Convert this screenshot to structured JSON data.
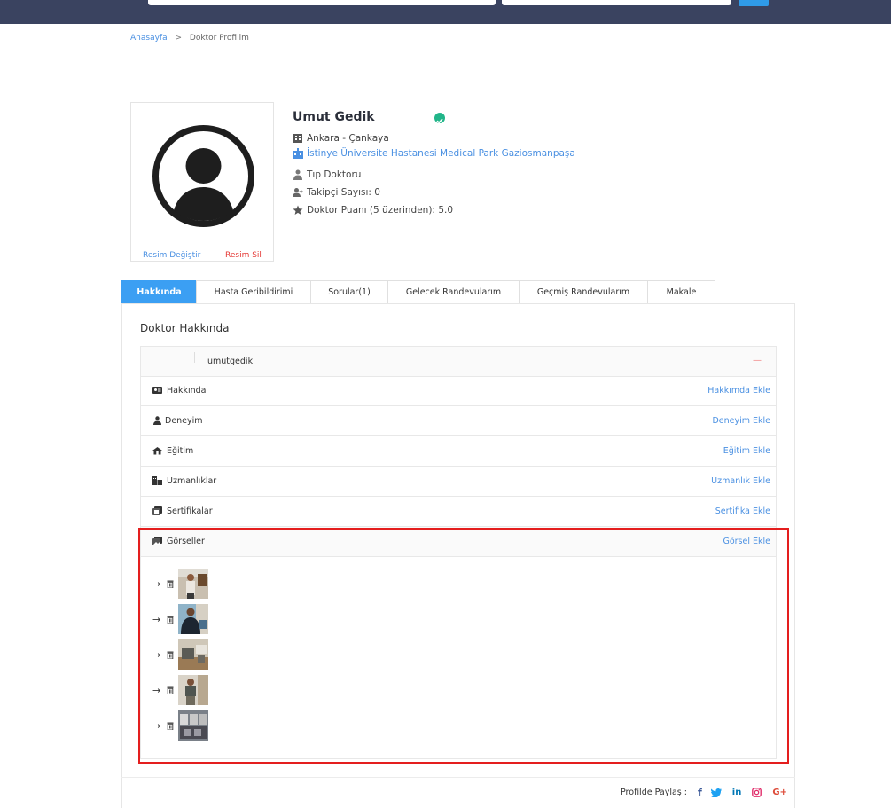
{
  "breadcrumb": {
    "home": "Anasayfa",
    "separator": ">",
    "current": "Doktor Profilim"
  },
  "photo": {
    "change_label": "Resim Değiştir",
    "delete_label": "Resim Sil"
  },
  "doctor": {
    "name": "Umut Gedik",
    "location": "Ankara - Çankaya",
    "hospital": "İstinye Üniversite Hastanesi Medical Park Gaziosmanpaşa",
    "title": "Tıp Doktoru",
    "followers": "Takipçi Sayısı: 0",
    "rating": "Doktor Puanı (5 üzerinden): 5.0"
  },
  "tabs": [
    {
      "label": "Hakkında",
      "active": true
    },
    {
      "label": "Hasta Geribildirimi"
    },
    {
      "label": "Sorular(1)"
    },
    {
      "label": "Gelecek Randevularım"
    },
    {
      "label": "Geçmiş Randevularım"
    },
    {
      "label": "Makale"
    }
  ],
  "about": {
    "title": "Doktor Hakkında",
    "username": "umutgedik",
    "collapse": "—",
    "sections": [
      {
        "label": "Hakkında",
        "action": "Hakkımda Ekle",
        "icon": "id-card-icon"
      },
      {
        "label": "Deneyim",
        "action": "Deneyim Ekle",
        "icon": "user-tie-icon"
      },
      {
        "label": "Eğitim",
        "action": "Eğitim Ekle",
        "icon": "graduation-icon"
      },
      {
        "label": "Uzmanlıklar",
        "action": "Uzmanlık Ekle",
        "icon": "user-md-icon"
      },
      {
        "label": "Sertifikalar",
        "action": "Sertifika Ekle",
        "icon": "certificate-icon"
      },
      {
        "label": "Görseller",
        "action": "Görsel Ekle",
        "icon": "images-icon"
      }
    ],
    "images": [
      {
        "arrow": "→"
      },
      {
        "arrow": "→"
      },
      {
        "arrow": "→"
      },
      {
        "arrow": "→"
      },
      {
        "arrow": "→"
      }
    ]
  },
  "share": {
    "label": "Profilde Paylaş :",
    "icons": [
      {
        "name": "facebook-icon",
        "glyph": "f",
        "color": "#3b5998"
      },
      {
        "name": "twitter-icon",
        "glyph": "🐦",
        "color": "#1da1f2"
      },
      {
        "name": "linkedin-icon",
        "glyph": "in",
        "color": "#0077b5"
      },
      {
        "name": "instagram-icon",
        "glyph": "◎",
        "color": "#e1306c"
      },
      {
        "name": "google-plus-icon",
        "glyph": "G+",
        "color": "#dd4b39"
      }
    ]
  },
  "colors": {
    "accent": "#3b9ff3",
    "link": "#4a90e2",
    "danger": "#e53935",
    "header": "#3a4360",
    "verified": "#21b589"
  }
}
